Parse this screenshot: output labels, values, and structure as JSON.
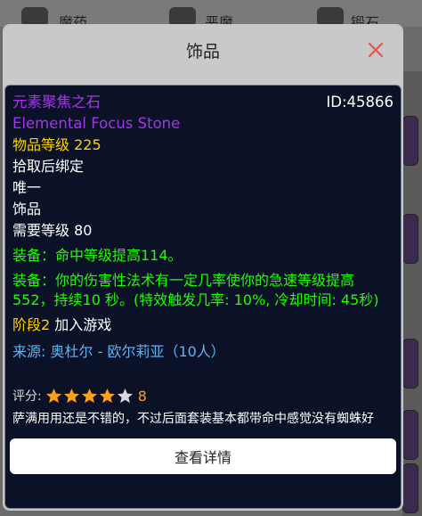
{
  "background": {
    "tabs": [
      {
        "label": "魔药"
      },
      {
        "label": "恶魔"
      },
      {
        "label": "锻石"
      }
    ]
  },
  "modal": {
    "title": "饰品",
    "close_icon": "close-icon"
  },
  "item": {
    "name": "元素聚焦之石",
    "name_en": "Elemental Focus Stone",
    "id": "ID:45866",
    "level_label": "物品等级",
    "level_value": "225",
    "binding": "拾取后绑定",
    "unique": "唯一",
    "slot": "饰品",
    "required_level": "需要等级 80",
    "equip1": "装备：命中等级提高114。",
    "equip2_line1": "装备：你的伤害性法术有一定几率使你的急速等级提高",
    "equip2_line2": "552，持续10 秒。(特效触发几率: 10%, 冷却时间: 45秒)",
    "phase_label": "阶段2",
    "phase_value": "加入游戏",
    "source_label": "来源:",
    "source_value": "奥杜尔 - 欧尔莉亚（10人）"
  },
  "rating": {
    "label": "评分:",
    "stars_filled": 4,
    "stars_total": 5,
    "value": "8"
  },
  "comment": "萨满用用还是不错的，不过后面套装基本都带命中感觉没有蜘蛛好",
  "details_button": "查看详情",
  "colors": {
    "epic": "#a335ee",
    "gold": "#ffd100",
    "green": "#1eff00",
    "blue": "#5fb4f0",
    "star": "#ff9f1a",
    "card_bg": "#0b1127"
  }
}
